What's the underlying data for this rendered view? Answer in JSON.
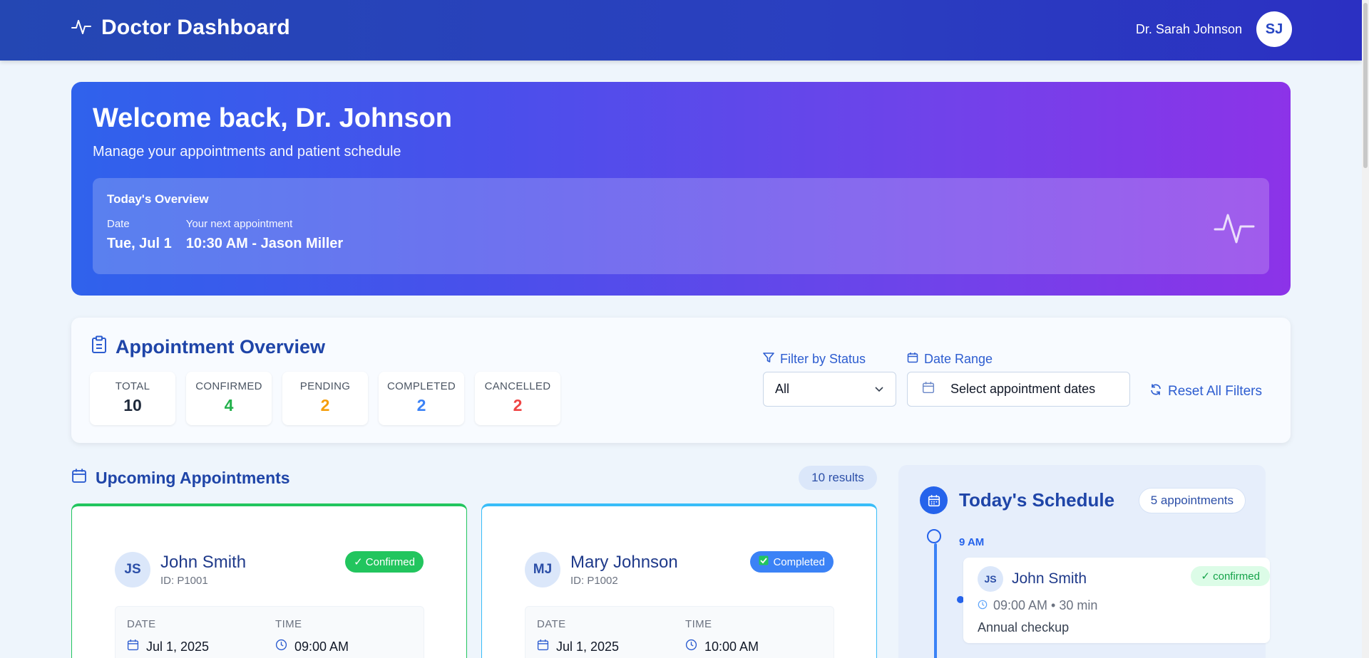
{
  "header": {
    "title": "Doctor Dashboard",
    "user_name": "Dr. Sarah Johnson",
    "user_initials": "SJ",
    "icon": "pulse-icon"
  },
  "hero": {
    "title": "Welcome back, Dr. Johnson",
    "subtitle": "Manage your appointments and patient schedule",
    "overview": {
      "title": "Today's Overview",
      "date_label": "Date",
      "date_value": "Tue, Jul 1",
      "next_label": "Your next appointment",
      "next_value": "10:30 AM - Jason Miller"
    }
  },
  "appointment_overview": {
    "title": "Appointment Overview",
    "stats": [
      {
        "label": "TOTAL",
        "value": "10"
      },
      {
        "label": "CONFIRMED",
        "value": "4"
      },
      {
        "label": "PENDING",
        "value": "2"
      },
      {
        "label": "COMPLETED",
        "value": "2"
      },
      {
        "label": "CANCELLED",
        "value": "2"
      }
    ],
    "filter_status_label": "Filter by Status",
    "filter_status_value": "All",
    "date_range_label": "Date Range",
    "date_range_placeholder": "Select appointment dates",
    "reset_label": "Reset All Filters"
  },
  "upcoming": {
    "title": "Upcoming Appointments",
    "results": "10 results",
    "cards": [
      {
        "initials": "JS",
        "name": "John Smith",
        "id": "ID: P1001",
        "status": "✓ Confirmed",
        "date_label": "DATE",
        "date": "Jul 1, 2025",
        "time_label": "TIME",
        "time": "09:00 AM"
      },
      {
        "initials": "MJ",
        "name": "Mary Johnson",
        "id": "ID: P1002",
        "status": "Completed",
        "date_label": "DATE",
        "date": "Jul 1, 2025",
        "time_label": "TIME",
        "time": "10:00 AM"
      }
    ]
  },
  "schedule": {
    "title": "Today's Schedule",
    "count": "5 appointments",
    "hour": "9 AM",
    "items": [
      {
        "initials": "JS",
        "name": "John Smith",
        "status": "✓ confirmed",
        "time": "09:00 AM • 30 min",
        "note": "Annual checkup"
      }
    ]
  },
  "colors": {
    "header": "#2a3fc0",
    "accent": "#1f45a8",
    "confirmed": "#22c55e",
    "pending": "#f59e0b",
    "completed": "#3b82f6",
    "cancelled": "#ef4444"
  }
}
